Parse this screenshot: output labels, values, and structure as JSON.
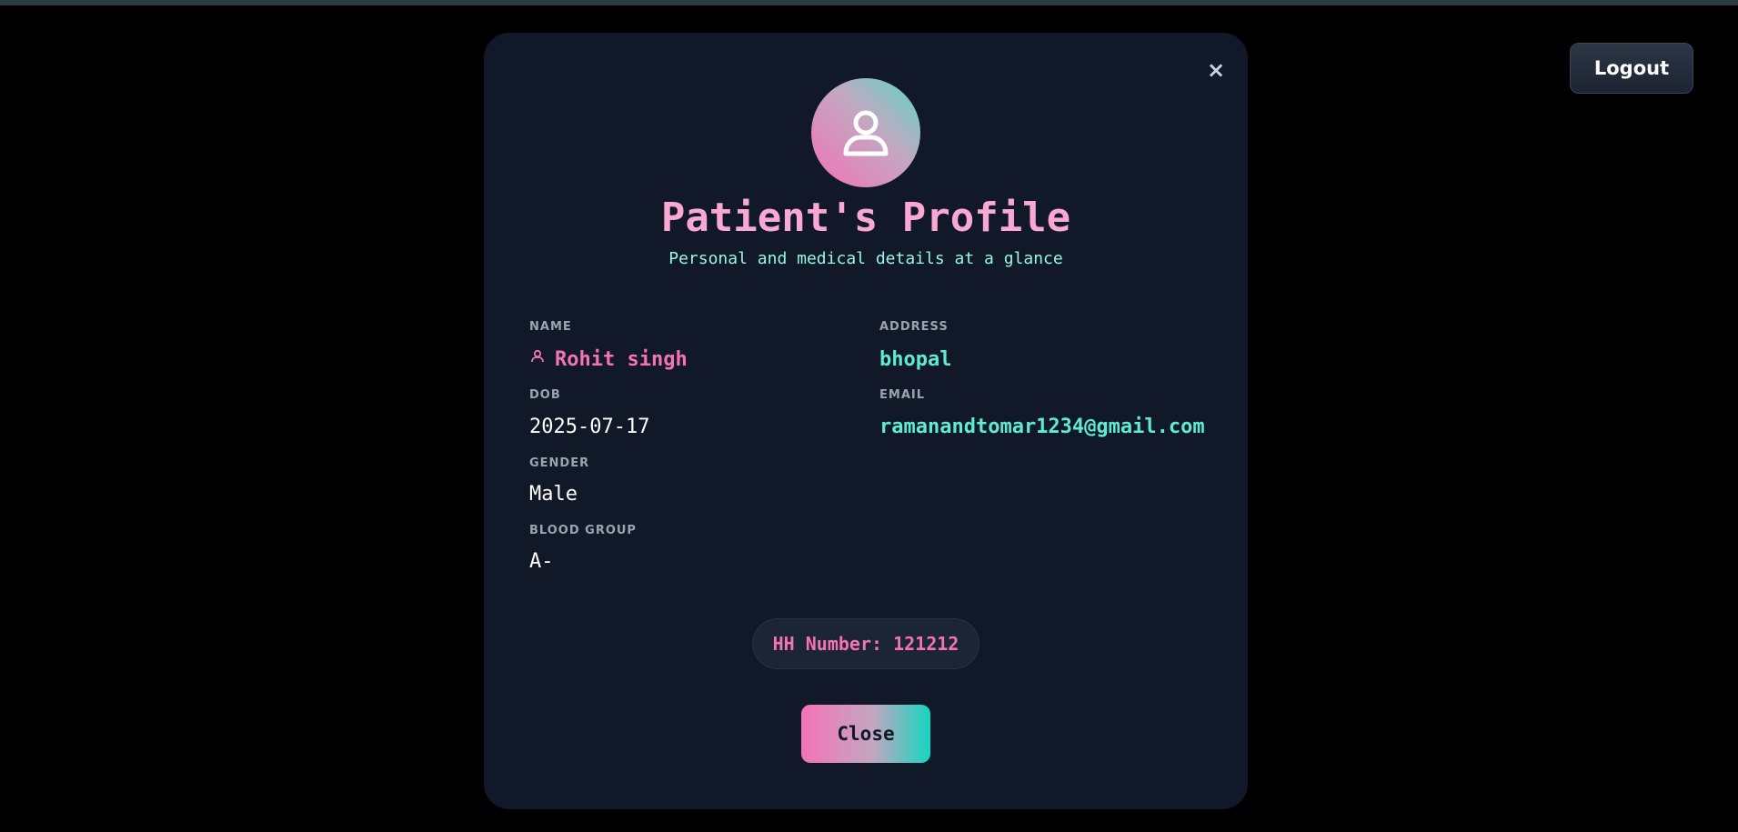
{
  "header": {
    "logout_label": "Logout"
  },
  "modal": {
    "close_symbol": "×",
    "avatar_icon": "user-icon",
    "title": "Patient's Profile",
    "subtitle": "Personal and medical details at a glance",
    "fields": {
      "name": {
        "label": "NAME",
        "value": "Rohit singh"
      },
      "address": {
        "label": "ADDRESS",
        "value": "bhopal"
      },
      "dob": {
        "label": "DOB",
        "value": "2025-07-17"
      },
      "email": {
        "label": "EMAIL",
        "value": "ramanandtomar1234@gmail.com"
      },
      "gender": {
        "label": "GENDER",
        "value": "Male"
      },
      "blood_group": {
        "label": "BLOOD GROUP",
        "value": "A-"
      }
    },
    "hh_number": "HH Number: 121212",
    "close_label": "Close"
  },
  "colors": {
    "background": "#000000",
    "modal_bg": "#111827",
    "title_pink": "#f9a8d4",
    "accent_pink": "#f472b6",
    "accent_cyan": "#5eead4",
    "subtitle_cyan": "#99f6e4"
  }
}
